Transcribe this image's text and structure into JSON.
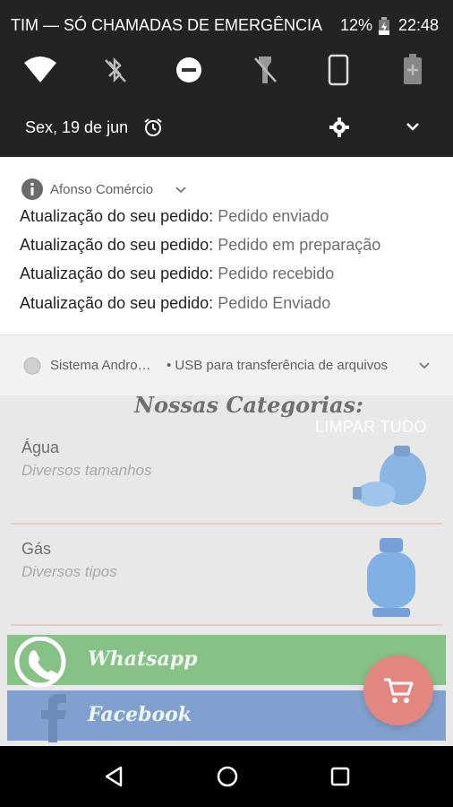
{
  "status_bar": {
    "carrier": "TIM — SÓ CHAMADAS DE EMERGÊNCIA",
    "battery": "12%",
    "time": "22:48"
  },
  "quick_settings": {
    "tiles": [
      "wifi-icon",
      "bluetooth-off-icon",
      "do-not-disturb-icon",
      "flashlight-off-icon",
      "rotation-icon",
      "battery-saver-icon"
    ],
    "date": "Sex, 19 de jun"
  },
  "notifications": [
    {
      "app": "Afonso Comércio",
      "lines": [
        {
          "label": "Atualização do seu pedido:",
          "value": "Pedido enviado"
        },
        {
          "label": "Atualização do seu pedido:",
          "value": "Pedido em preparação"
        },
        {
          "label": "Atualização do seu pedido:",
          "value": "Pedido recebido"
        },
        {
          "label": "Atualização do seu pedido:",
          "value": "Pedido Enviado"
        }
      ]
    },
    {
      "app": "Sistema Andro…",
      "text": "• USB para transferência de arquivos"
    }
  ],
  "clear_all": "LIMPAR TUDO",
  "app": {
    "categories_title": "Nossas Categorias:",
    "categories": [
      {
        "name": "Água",
        "desc": "Diversos tamanhos"
      },
      {
        "name": "Gás",
        "desc": "Diversos tipos"
      }
    ],
    "social": {
      "whatsapp": "Whatsapp",
      "facebook": "Facebook"
    }
  },
  "colors": {
    "accent": "#d5463b",
    "whatsapp": "#46a046",
    "facebook": "#3d6fb5"
  }
}
